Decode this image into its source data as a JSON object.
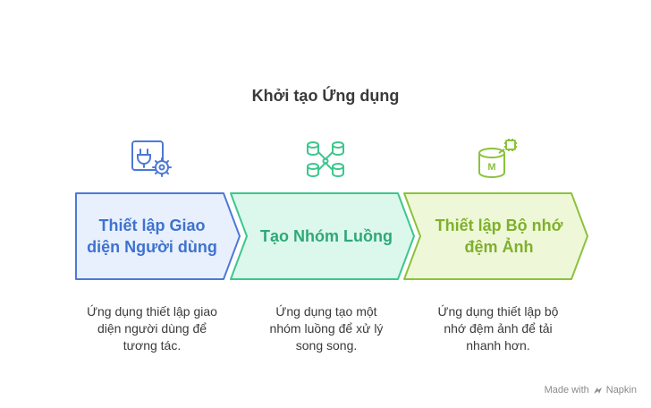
{
  "title": "Khởi tạo Ứng dụng",
  "steps": [
    {
      "label": "Thiết lập Giao diện Người dùng",
      "description": "Ứng dụng thiết lập giao diện người dùng để tương tác.",
      "icon": "ui-settings-icon",
      "color": "#3f72cf",
      "fill": "#e8f0fd",
      "stroke": "#4d79d6"
    },
    {
      "label": "Tạo Nhóm Luồng",
      "description": "Ứng dụng tạo một nhóm luồng để xử lý song song.",
      "icon": "database-network-icon",
      "color": "#2fa878",
      "fill": "#dcf8ec",
      "stroke": "#3cc78d"
    },
    {
      "label": "Thiết lập Bộ nhớ đệm Ảnh",
      "description": "Ứng dụng thiết lập bộ nhớ đệm ảnh để tải nhanh hơn.",
      "icon": "memory-cache-icon",
      "color": "#7fb02c",
      "fill": "#eef8d8",
      "stroke": "#8cc23c"
    }
  ],
  "footer": {
    "made_with": "Made with",
    "brand": "Napkin"
  }
}
